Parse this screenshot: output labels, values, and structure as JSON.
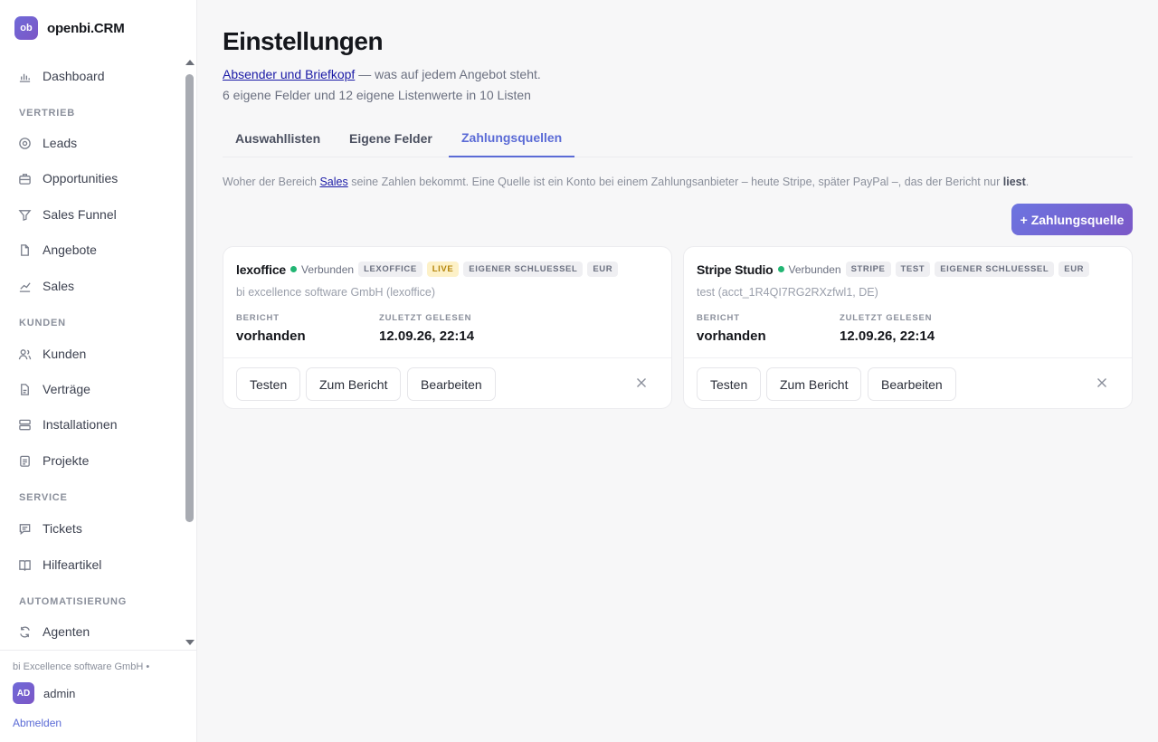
{
  "brand": {
    "logo": "ob",
    "name": "openbi.CRM"
  },
  "sidebar": {
    "dashboard": "Dashboard",
    "sections": {
      "vertrieb": "VERTRIEB",
      "kunden": "KUNDEN",
      "service": "SERVICE",
      "automatisierung": "AUTOMATISIERUNG"
    },
    "items": {
      "leads": "Leads",
      "opportunities": "Opportunities",
      "funnel": "Sales Funnel",
      "angebote": "Angebote",
      "sales": "Sales",
      "kunden": "Kunden",
      "vertraege": "Verträge",
      "installationen": "Installationen",
      "projekte": "Projekte",
      "tickets": "Tickets",
      "hilfeartikel": "Hilfeartikel",
      "agenten": "Agenten"
    },
    "footer": {
      "org": "bi Excellence software GmbH  •",
      "avatar": "AD",
      "user": "admin",
      "logout": "Abmelden"
    }
  },
  "page": {
    "title": "Einstellungen",
    "sub_link": "Absender und Briefkopf",
    "sub_rest": " — was auf jedem Angebot steht.",
    "sub2": "6 eigene Felder und 12 eigene Listenwerte in 10 Listen"
  },
  "tabs": [
    "Auswahllisten",
    "Eigene Felder",
    "Zahlungsquellen"
  ],
  "description": {
    "before": "Woher der Bereich ",
    "link": "Sales",
    "middle": " seine Zahlen bekommt. Eine Quelle ist ein Konto bei einem Zahlungsanbieter – heute Stripe, später PayPal –, das der Bericht nur ",
    "bold": "liest",
    "end": "."
  },
  "add_button": "+ Zahlungsquelle",
  "labels": {
    "bericht": "BERICHT",
    "zuletzt": "ZULETZT GELESEN",
    "testen": "Testen",
    "zum_bericht": "Zum Bericht",
    "bearbeiten": "Bearbeiten"
  },
  "sources": [
    {
      "name": "lexoffice",
      "status": "Verbunden",
      "badges": [
        "LEXOFFICE",
        "LIVE",
        "EIGENER SCHLUESSEL",
        "EUR"
      ],
      "sub": "bi excellence software GmbH (lexoffice)",
      "bericht": "vorhanden",
      "zuletzt": "12.09.26, 22:14"
    },
    {
      "name": "Stripe Studio",
      "status": "Verbunden",
      "badges": [
        "STRIPE",
        "TEST",
        "EIGENER SCHLUESSEL",
        "EUR"
      ],
      "sub": "test (acct_1R4QI7RG2RXzfwl1, DE)",
      "bericht": "vorhanden",
      "zuletzt": "12.09.26, 22:14"
    }
  ],
  "colors": {
    "accent": "#5b6bd6",
    "status_ok": "#22b573",
    "live_badge": "#fdf1c8"
  }
}
